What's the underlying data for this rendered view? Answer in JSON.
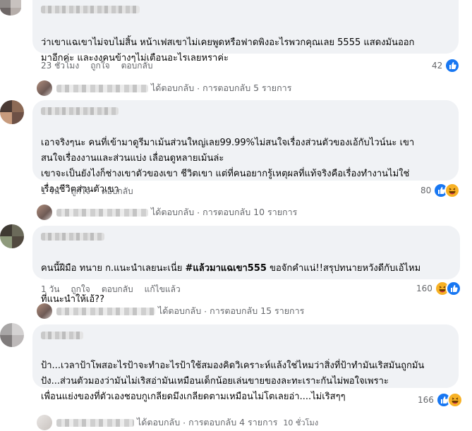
{
  "comments": [
    {
      "text_lines": [
        "ว่าเขาแฉเขาไม่จบไม่สิ้น หน้าเฟสเขาไม่เคยพูดหรือฟาดพิงอะไรพวกคุณเลย 5555 แสดงมันออก",
        "มาอีกค่ะ และงงคนข้างๆไม่เตือนอะไรเลยหราค่ะ"
      ],
      "time": "23 ชั่วโมง",
      "like_label": "ถูกใจ",
      "reply_label": "ตอบกลับ",
      "reaction_count": "42",
      "reaction_icons": [
        "like-icon"
      ],
      "replies": {
        "prefix": "ได้ตอบกลับ",
        "sep": "·",
        "count_text": "การตอบกลับ 5 รายการ"
      }
    },
    {
      "text_lines": [
        "เอาจริงๆนะ คนที่เข้ามาดูรีมาเม้นส่วนใหญ่เลย99.99%ไม่สนใจเรื่องส่วนตัวของเอ้กับไวน์นะ เขา",
        "สนใจเรื่องงานและส่วนแบ่ง เลื่อนดูหลายเม้นล่ะ",
        "เขาจะเป็นยังไงก็ช่างเขาตัวของเขา ชีวิตเขา แต่ที่คนอยากรู้เหตุผลที่แท้จริงคือเรื่องทำงานไม่ใช่",
        "เรื่องชีวิตส่วนตัวเขา"
      ],
      "time": "1 วัน",
      "like_label": "ถูกใจ",
      "reply_label": "ตอบกลับ",
      "reaction_count": "80",
      "reaction_icons": [
        "like-icon",
        "haha-icon"
      ],
      "replies": {
        "prefix": "ได้ตอบกลับ",
        "sep": "·",
        "count_text": "การตอบกลับ 10 รายการ"
      }
    },
    {
      "text_pre": "คนนี้ฝีมือ ทนาย ก.แนะนำเลยนะเนี่ย ",
      "hashtag": "#แล้วมาแฉเขา555",
      "text_post": " ขอจักคำแน่!!สรุปทนายหวังดีกับเอ้ไหม",
      "text_line2": "ที่แนะนำให้เอ้??",
      "time": "1 วัน",
      "like_label": "ถูกใจ",
      "reply_label": "ตอบกลับ",
      "edited_label": "แก้ไขแล้ว",
      "reaction_count": "160",
      "reaction_icons": [
        "haha-icon",
        "like-icon"
      ],
      "replies": {
        "prefix": "ได้ตอบกลับ",
        "sep": "·",
        "count_text": "การตอบกลับ 15 รายการ"
      }
    },
    {
      "text_lines": [
        "ป้า...เวลาป้าโพสอะไรป้าจะทำอะไรป้าใช้สมองคิดวิเคราะห์แล้งใช่ไหมว่าสิ่งที่ป้าทำมันเริสมันถูกมัน",
        "ปัง...ส่วนตัวมองว่ามันไม่เริสอ่ามันเหมือนเด็กน้อยเล่นขายของละทะเราะกันไม่พอใจเพราะ",
        "เพื่อนแย่งของที่ตัวเองชอบกูเกลียดมึงเกลียดตามเหมือนไม่โตเลยอ่า....ไม่เริสๆๆ"
      ],
      "reaction_count": "166",
      "reaction_icons": [
        "like-icon",
        "haha-icon"
      ],
      "replies": {
        "prefix": "ได้ตอบกลับ",
        "sep": "·",
        "count_text": "การตอบกลับ 4 รายการ",
        "time": "10 ชั่วโมง"
      }
    }
  ],
  "colors": {
    "bubble": "#f0f2f5",
    "meta": "#65676b",
    "like": "#1877f2",
    "haha": "#f7b125"
  }
}
